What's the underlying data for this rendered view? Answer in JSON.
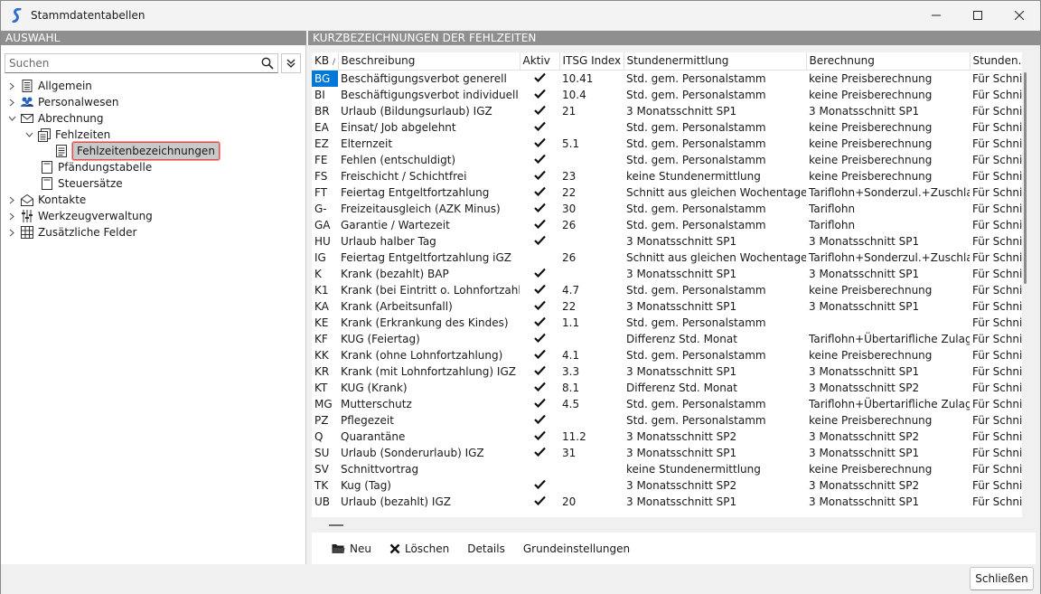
{
  "window": {
    "title": "Stammdatentabellen"
  },
  "left": {
    "header": "AUSWAHL",
    "search_placeholder": "Suchen",
    "tree": [
      {
        "label": "Allgemein",
        "icon": "table-icon",
        "level": 0,
        "expanded": false
      },
      {
        "label": "Personalwesen",
        "icon": "people-icon",
        "level": 0,
        "expanded": false
      },
      {
        "label": "Abrechnung",
        "icon": "envelope-icon",
        "level": 0,
        "expanded": true
      },
      {
        "label": "Fehlzeiten",
        "icon": "documents-icon",
        "level": 1,
        "expanded": true
      },
      {
        "label": "Fehlzeitenbezeichnungen",
        "icon": "document-icon",
        "level": 2,
        "selected": true
      },
      {
        "label": "Pfändungstabelle",
        "icon": "document-icon",
        "level": 1
      },
      {
        "label": "Steuersätze",
        "icon": "document-icon",
        "level": 1
      },
      {
        "label": "Kontakte",
        "icon": "envelope-open-icon",
        "level": 0,
        "expanded": false
      },
      {
        "label": "Werkzeugverwaltung",
        "icon": "sliders-icon",
        "level": 0,
        "expanded": false
      },
      {
        "label": "Zusätzliche Felder",
        "icon": "grid-icon",
        "level": 0,
        "expanded": false
      }
    ]
  },
  "right": {
    "header": "KURZBEZEICHNUNGEN DER FEHLZEITEN",
    "columns": [
      "KB",
      "Beschreibung",
      "Aktiv",
      "ITSG Index",
      "Stundenermittlung",
      "Berechnung",
      "Stunden..."
    ],
    "sort_indicator": "/",
    "rows": [
      {
        "kb": "BG",
        "desc": "Beschäftigungsverbot generell",
        "aktiv": true,
        "itsg": "10.41",
        "std": "Std. gem. Personalstamm",
        "ber": "keine Preisberechnung",
        "stunden": "Für Schnitt"
      },
      {
        "kb": "BI",
        "desc": "Beschäftigungsverbot individuell",
        "aktiv": true,
        "itsg": "10.4",
        "std": "Std. gem. Personalstamm",
        "ber": "keine Preisberechnung",
        "stunden": "Für Schnitt"
      },
      {
        "kb": "BR",
        "desc": "Urlaub (Bildungsurlaub) IGZ",
        "aktiv": true,
        "itsg": "21",
        "std": "3 Monatsschnitt SP1",
        "ber": "3 Monatsschnitt SP1",
        "stunden": "Für Schnitt"
      },
      {
        "kb": "EA",
        "desc": "Einsat/ Job abgelehnt",
        "aktiv": true,
        "itsg": "",
        "std": "Std. gem. Personalstamm",
        "ber": "keine Preisberechnung",
        "stunden": "Für Schnitt"
      },
      {
        "kb": "EZ",
        "desc": "Elternzeit",
        "aktiv": true,
        "itsg": "5.1",
        "std": "Std. gem. Personalstamm",
        "ber": "keine Preisberechnung",
        "stunden": "Für Schnitt"
      },
      {
        "kb": "FE",
        "desc": "Fehlen (entschuldigt)",
        "aktiv": true,
        "itsg": "",
        "std": "Std. gem. Personalstamm",
        "ber": "keine Preisberechnung",
        "stunden": "Für Schnitt"
      },
      {
        "kb": "FS",
        "desc": "Freischicht / Schichtfrei",
        "aktiv": true,
        "itsg": "23",
        "std": "keine Stundenermittlung",
        "ber": "keine Preisberechnung",
        "stunden": "Für Schnitt"
      },
      {
        "kb": "FT",
        "desc": "Feiertag Entgeltfortzahlung",
        "aktiv": true,
        "itsg": "22",
        "std": "Schnitt aus gleichen Wochentagen",
        "ber": "Tariflohn+Sonderzul.+Zuschlag+Ü",
        "stunden": "Für Schnitt"
      },
      {
        "kb": "G-",
        "desc": "Freizeitausgleich (AZK Minus)",
        "aktiv": true,
        "itsg": "30",
        "std": "Std. gem. Personalstamm",
        "ber": "Tariflohn",
        "stunden": "Für Schnitt"
      },
      {
        "kb": "GA",
        "desc": "Garantie / Wartezeit",
        "aktiv": true,
        "itsg": "26",
        "std": "Std. gem. Personalstamm",
        "ber": "Tariflohn",
        "stunden": "Für Schnitt"
      },
      {
        "kb": "HU",
        "desc": "Urlaub halber Tag",
        "aktiv": true,
        "itsg": "",
        "std": "3 Monatsschnitt SP1",
        "ber": "3 Monatsschnitt SP1",
        "stunden": "Für Schnitt"
      },
      {
        "kb": "IG",
        "desc": "Feiertag Entgeltfortzahlung iGZ",
        "aktiv": false,
        "itsg": "26",
        "std": "Schnitt aus gleichen Wochentagen",
        "ber": "Tariflohn+Sonderzul.+Zuschlag+Ü",
        "stunden": "Für Schnitt"
      },
      {
        "kb": "K",
        "desc": "Krank (bezahlt) BAP",
        "aktiv": true,
        "itsg": "",
        "std": "3 Monatsschnitt SP1",
        "ber": "3 Monatsschnitt SP1",
        "stunden": "Für Schnitt"
      },
      {
        "kb": "K1",
        "desc": "Krank (bei Eintritt o. Lohnfortzahlung)",
        "aktiv": true,
        "itsg": "4.7",
        "std": "Std. gem. Personalstamm",
        "ber": "keine Preisberechnung",
        "stunden": "Für Schnitt"
      },
      {
        "kb": "KA",
        "desc": "Krank (Arbeitsunfall)",
        "aktiv": true,
        "itsg": "22",
        "std": "3 Monatsschnitt SP1",
        "ber": "3 Monatsschnitt SP1",
        "stunden": "Für Schnitt"
      },
      {
        "kb": "KE",
        "desc": "Krank (Erkrankung des Kindes)",
        "aktiv": true,
        "itsg": "1.1",
        "std": "Std. gem. Personalstamm",
        "ber": "",
        "stunden": "Für Schnitt"
      },
      {
        "kb": "KF",
        "desc": "KUG (Feiertag)",
        "aktiv": true,
        "itsg": "",
        "std": "Differenz Std. Monat",
        "ber": "Tariflohn+Übertarifliche Zulage",
        "stunden": "Für Schnitt"
      },
      {
        "kb": "KK",
        "desc": "Krank (ohne Lohnfortzahlung)",
        "aktiv": true,
        "itsg": "4.1",
        "std": "Std. gem. Personalstamm",
        "ber": "keine Preisberechnung",
        "stunden": "Für Schnitt"
      },
      {
        "kb": "KR",
        "desc": "Krank (mit Lohnfortzahlung) IGZ",
        "aktiv": true,
        "itsg": "3.3",
        "std": "3 Monatsschnitt SP1",
        "ber": "3 Monatsschnitt SP1",
        "stunden": "Für Schnitt"
      },
      {
        "kb": "KT",
        "desc": "KUG (Krank)",
        "aktiv": true,
        "itsg": "8.1",
        "std": "Differenz Std. Monat",
        "ber": "3 Monatsschnitt SP2",
        "stunden": "Für Schnitt"
      },
      {
        "kb": "MG",
        "desc": "Mutterschutz",
        "aktiv": true,
        "itsg": "4.5",
        "std": "Std. gem. Personalstamm",
        "ber": "Tariflohn+Übertarifliche Zulage",
        "stunden": "Für Schnitt"
      },
      {
        "kb": "PZ",
        "desc": "Pflegezeit",
        "aktiv": true,
        "itsg": "",
        "std": "Std. gem. Personalstamm",
        "ber": "keine Preisberechnung",
        "stunden": "Für Schnitt"
      },
      {
        "kb": "Q",
        "desc": "Quarantäne",
        "aktiv": true,
        "itsg": "11.2",
        "std": "3 Monatsschnitt SP2",
        "ber": "3 Monatsschnitt SP2",
        "stunden": "Für Schnitt"
      },
      {
        "kb": "SU",
        "desc": "Urlaub (Sonderurlaub) IGZ",
        "aktiv": true,
        "itsg": "31",
        "std": "3 Monatsschnitt SP1",
        "ber": "3 Monatsschnitt SP1",
        "stunden": "Für Schnitt"
      },
      {
        "kb": "SV",
        "desc": "Schnittvortrag",
        "aktiv": false,
        "itsg": "",
        "std": "keine Stundenermittlung",
        "ber": "keine Preisberechnung",
        "stunden": "Für Schnitt"
      },
      {
        "kb": "TK",
        "desc": "Kug (Tag)",
        "aktiv": true,
        "itsg": "",
        "std": "3 Monatsschnitt SP2",
        "ber": "3 Monatsschnitt SP2",
        "stunden": "Für Schnitt"
      },
      {
        "kb": "UB",
        "desc": "Urlaub (bezahlt) IGZ",
        "aktiv": true,
        "itsg": "20",
        "std": "3 Monatsschnitt SP1",
        "ber": "3 Monatsschnitt SP1",
        "stunden": "Für Schnitt"
      }
    ],
    "toolbar": {
      "neu": "Neu",
      "loeschen": "Löschen",
      "details": "Details",
      "grundeinstellungen": "Grundeinstellungen"
    }
  },
  "footer": {
    "close_label": "Schließen"
  },
  "colors": {
    "header_bg": "#8f8f8f",
    "selection": "#0078d7",
    "tree_selection_border": "#e0504f"
  }
}
